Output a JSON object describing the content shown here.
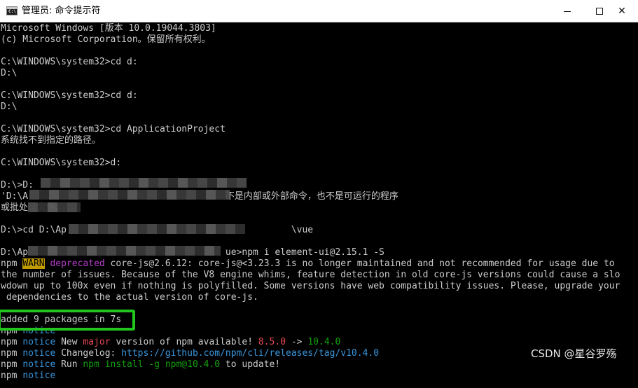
{
  "window": {
    "title": "管理员: 命令提示符",
    "icon_prompt": "C:\\"
  },
  "controls": {
    "minimize": "minimize-icon",
    "maximize": "maximize-icon",
    "close": "close-icon",
    "close_glyph": "✕"
  },
  "console": {
    "lines": [
      [
        [
          "Microsoft Windows [版本 10.0.19044.3803]",
          "w"
        ]
      ],
      [
        [
          "(c) Microsoft Corporation。保留所有权利。",
          "w"
        ]
      ],
      [
        [
          "",
          "w"
        ]
      ],
      [
        [
          "C:\\WINDOWS\\system32>cd d:",
          "w"
        ]
      ],
      [
        [
          "D:\\",
          "w"
        ]
      ],
      [
        [
          "",
          "w"
        ]
      ],
      [
        [
          "C:\\WINDOWS\\system32>cd d:",
          "w"
        ]
      ],
      [
        [
          "D:\\",
          "w"
        ]
      ],
      [
        [
          "",
          "w"
        ]
      ],
      [
        [
          "C:\\WINDOWS\\system32>cd ApplicationProject",
          "w"
        ]
      ],
      [
        [
          "系统找不到指定的路径。",
          "w"
        ]
      ],
      [
        [
          "",
          "w"
        ]
      ],
      [
        [
          "C:\\WINDOWS\\system32>d:",
          "w"
        ]
      ],
      [
        [
          "",
          "w"
        ]
      ],
      [
        [
          "D:\\>D:",
          "w"
        ]
      ],
      [
        [
          "'D:\\A",
          "w"
        ],
        [
          "                                    ",
          "w"
        ],
        [
          "不是内部或外部命令，也不是可运行的程序",
          "w"
        ]
      ],
      [
        [
          "或批处理文件。",
          "w"
        ]
      ],
      [
        [
          "",
          "w"
        ]
      ],
      [
        [
          "D:\\>cd D:\\Ap",
          "w"
        ],
        [
          "                                         ",
          "w"
        ],
        [
          "\\vue",
          "w"
        ]
      ],
      [
        [
          "",
          "w"
        ]
      ],
      [
        [
          "D:\\Ap",
          "w"
        ],
        [
          "                                    ",
          "w"
        ],
        [
          "ue>npm i element-ui@2.15.1 -S",
          "w"
        ]
      ],
      [
        [
          "npm ",
          "w"
        ],
        [
          "WARN",
          "ybg"
        ],
        [
          " ",
          "w"
        ],
        [
          "deprecated",
          "m"
        ],
        [
          " core-js@2.6.12: core-js@<3.23.3 is no longer maintained and not recommended for usage due to",
          "w"
        ]
      ],
      [
        [
          "the number of issues. Because of the V8 engine whims, feature detection in old core-js versions could cause a slo",
          "w"
        ]
      ],
      [
        [
          "wdown up to 100x even if nothing is polyfilled. Some versions have web compatibility issues. Please, upgrade your",
          "w"
        ]
      ],
      [
        [
          " dependencies to the actual version of core-js.",
          "w"
        ]
      ],
      [
        [
          "",
          "w"
        ]
      ],
      [
        [
          "added 9 packages in 7s",
          "w"
        ]
      ],
      [
        [
          "npm ",
          "w"
        ],
        [
          "notice",
          "c"
        ]
      ],
      [
        [
          "npm ",
          "w"
        ],
        [
          "notice",
          "c"
        ],
        [
          " New ",
          "w"
        ],
        [
          "major",
          "r"
        ],
        [
          " version of npm available! ",
          "w"
        ],
        [
          "8.5.0",
          "r"
        ],
        [
          " -> ",
          "w"
        ],
        [
          "10.4.0",
          "g"
        ]
      ],
      [
        [
          "npm ",
          "w"
        ],
        [
          "notice",
          "c"
        ],
        [
          " Changelog: ",
          "w"
        ],
        [
          "https://github.com/npm/cli/releases/tag/v10.4.0",
          "c"
        ]
      ],
      [
        [
          "npm ",
          "w"
        ],
        [
          "notice",
          "c"
        ],
        [
          " Run ",
          "w"
        ],
        [
          "npm install -g npm@10.4.0",
          "g"
        ],
        [
          " to update!",
          "w"
        ]
      ],
      [
        [
          "npm ",
          "w"
        ],
        [
          "notice",
          "c"
        ]
      ]
    ]
  },
  "watermark": "CSDN @星谷罗殇"
}
